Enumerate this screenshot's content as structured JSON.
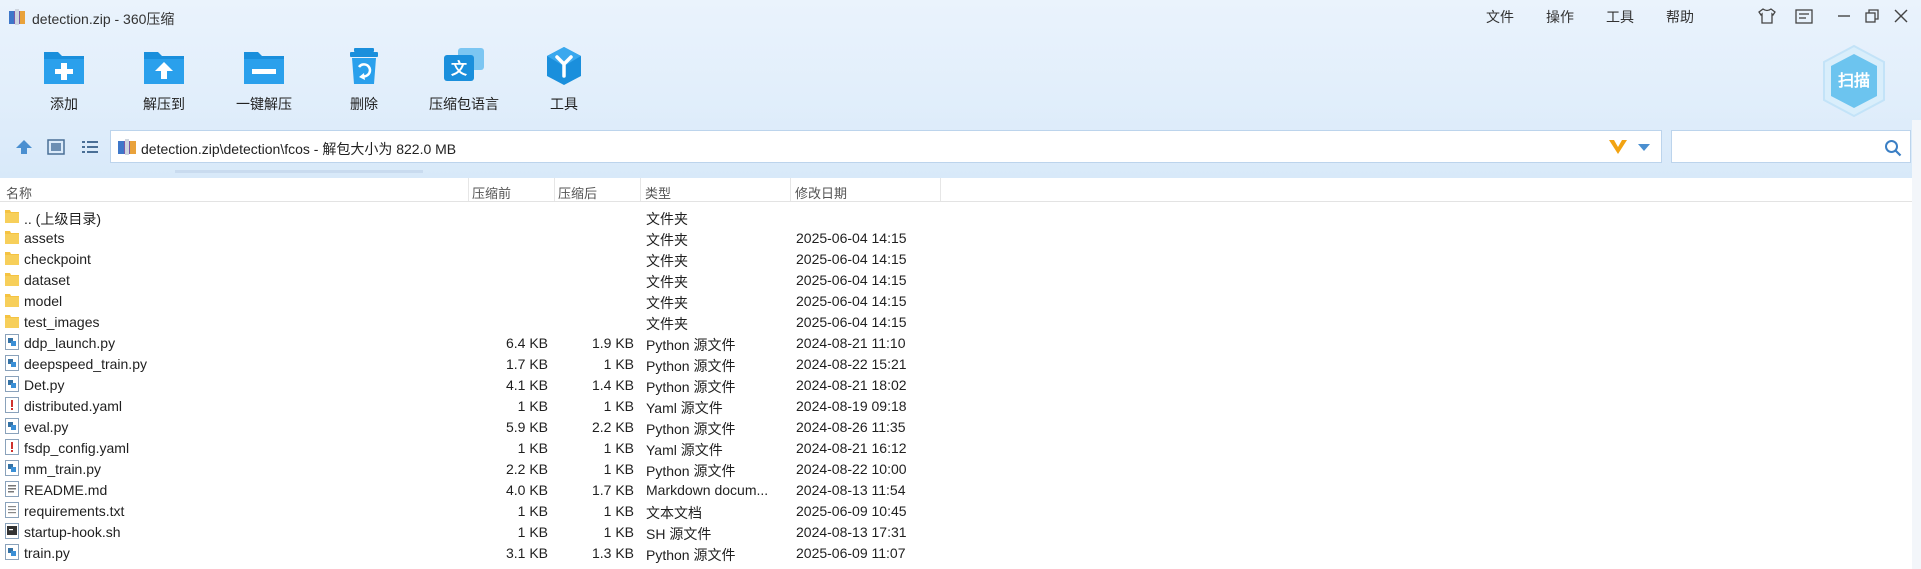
{
  "window": {
    "title": "detection.zip - 360压缩",
    "menus": [
      "文件",
      "操作",
      "工具",
      "帮助"
    ],
    "controls": [
      "skin-icon",
      "menu-icon",
      "minimize-icon",
      "restore-icon",
      "close-icon"
    ]
  },
  "toolbar": {
    "buttons": [
      {
        "label": "添加",
        "icon": "add-icon"
      },
      {
        "label": "解压到",
        "icon": "extract-to-icon"
      },
      {
        "label": "一键解压",
        "icon": "one-click-extract-icon"
      },
      {
        "label": "删除",
        "icon": "delete-icon"
      },
      {
        "label": "压缩包语言",
        "icon": "archive-language-icon"
      },
      {
        "label": "工具",
        "icon": "tools-icon"
      }
    ],
    "scan_label": "扫描"
  },
  "address": {
    "path": "detection.zip\\detection\\fcos - 解包大小为 822.0 MB"
  },
  "search": {
    "placeholder": ""
  },
  "columns": {
    "name": "名称",
    "packed": "压缩前",
    "compressed": "压缩后",
    "type": "类型",
    "modified": "修改日期"
  },
  "files": [
    {
      "name": ".. (上级目录)",
      "packed": "",
      "compressed": "",
      "type": "文件夹",
      "modified": "",
      "icon": "folder-icon"
    },
    {
      "name": "assets",
      "packed": "",
      "compressed": "",
      "type": "文件夹",
      "modified": "2025-06-04 14:15",
      "icon": "folder-icon"
    },
    {
      "name": "checkpoint",
      "packed": "",
      "compressed": "",
      "type": "文件夹",
      "modified": "2025-06-04 14:15",
      "icon": "folder-icon"
    },
    {
      "name": "dataset",
      "packed": "",
      "compressed": "",
      "type": "文件夹",
      "modified": "2025-06-04 14:15",
      "icon": "folder-icon"
    },
    {
      "name": "model",
      "packed": "",
      "compressed": "",
      "type": "文件夹",
      "modified": "2025-06-04 14:15",
      "icon": "folder-icon"
    },
    {
      "name": "test_images",
      "packed": "",
      "compressed": "",
      "type": "文件夹",
      "modified": "2025-06-04 14:15",
      "icon": "folder-icon"
    },
    {
      "name": "ddp_launch.py",
      "packed": "6.4 KB",
      "compressed": "1.9 KB",
      "type": "Python 源文件",
      "modified": "2024-08-21 11:10",
      "icon": "python-file-icon"
    },
    {
      "name": "deepspeed_train.py",
      "packed": "1.7 KB",
      "compressed": "1 KB",
      "type": "Python 源文件",
      "modified": "2024-08-22 15:21",
      "icon": "python-file-icon"
    },
    {
      "name": "Det.py",
      "packed": "4.1 KB",
      "compressed": "1.4 KB",
      "type": "Python 源文件",
      "modified": "2024-08-21 18:02",
      "icon": "python-file-icon"
    },
    {
      "name": "distributed.yaml",
      "packed": "1 KB",
      "compressed": "1 KB",
      "type": "Yaml 源文件",
      "modified": "2024-08-19 09:18",
      "icon": "yaml-file-icon"
    },
    {
      "name": "eval.py",
      "packed": "5.9 KB",
      "compressed": "2.2 KB",
      "type": "Python 源文件",
      "modified": "2024-08-26 11:35",
      "icon": "python-file-icon"
    },
    {
      "name": "fsdp_config.yaml",
      "packed": "1 KB",
      "compressed": "1 KB",
      "type": "Yaml 源文件",
      "modified": "2024-08-21 16:12",
      "icon": "yaml-file-icon"
    },
    {
      "name": "mm_train.py",
      "packed": "2.2 KB",
      "compressed": "1 KB",
      "type": "Python 源文件",
      "modified": "2024-08-22 10:00",
      "icon": "python-file-icon"
    },
    {
      "name": "README.md",
      "packed": "4.0 KB",
      "compressed": "1.7 KB",
      "type": "Markdown docum...",
      "modified": "2024-08-13 11:54",
      "icon": "markdown-file-icon"
    },
    {
      "name": "requirements.txt",
      "packed": "1 KB",
      "compressed": "1 KB",
      "type": "文本文档",
      "modified": "2025-06-09 10:45",
      "icon": "text-file-icon"
    },
    {
      "name": "startup-hook.sh",
      "packed": "1 KB",
      "compressed": "1 KB",
      "type": "SH 源文件",
      "modified": "2024-08-13 17:31",
      "icon": "shell-file-icon"
    },
    {
      "name": "train.py",
      "packed": "3.1 KB",
      "compressed": "1.3 KB",
      "type": "Python 源文件",
      "modified": "2025-06-09 11:07",
      "icon": "python-file-icon"
    }
  ],
  "colors": {
    "accent": "#1a8fdc",
    "folder": "#f5c342",
    "scan_badge": "#6cc4ef"
  }
}
